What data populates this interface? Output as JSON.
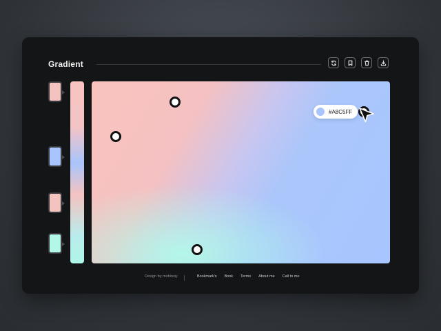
{
  "app": {
    "title": "Gradient"
  },
  "toolbar": {
    "buttons": [
      {
        "icon": "refresh-icon"
      },
      {
        "icon": "bookmark-icon"
      },
      {
        "icon": "trash-icon"
      },
      {
        "icon": "download-icon"
      }
    ]
  },
  "swatches": [
    {
      "color": "#f4c3bf"
    },
    {
      "color": "#a8c5ff"
    },
    {
      "color": "#f4c3bf"
    },
    {
      "color": "#b2f7e8"
    }
  ],
  "picker": {
    "hex": "#A8C5FF",
    "color": "#a8c5ff"
  },
  "footer": {
    "credit": "Design by mobinsiy",
    "links": [
      "Bookmark's",
      "Book",
      "Terms",
      "About me",
      "Call to me"
    ]
  }
}
